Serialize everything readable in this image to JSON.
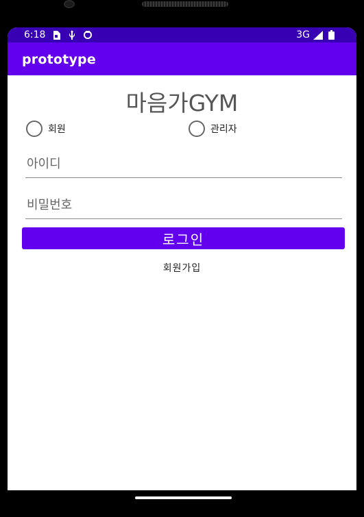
{
  "status_bar": {
    "time": "6:18",
    "left_icons": [
      "sim-card-icon",
      "usb-icon",
      "sync-icon"
    ],
    "network": "3G",
    "right_icons": [
      "signal-icon",
      "battery-icon"
    ]
  },
  "app_bar": {
    "title": "prototype"
  },
  "main": {
    "heading": "마음가GYM",
    "radios": [
      {
        "label": "회원",
        "selected": false
      },
      {
        "label": "관리자",
        "selected": false
      }
    ],
    "id_field": {
      "placeholder": "아이디",
      "value": ""
    },
    "password_field": {
      "placeholder": "비밀번호",
      "value": ""
    },
    "login_label": "로그인",
    "signup_label": "회원가입"
  },
  "colors": {
    "status_bar": "#3700b3",
    "primary": "#6200ee",
    "background": "#ffffff"
  }
}
